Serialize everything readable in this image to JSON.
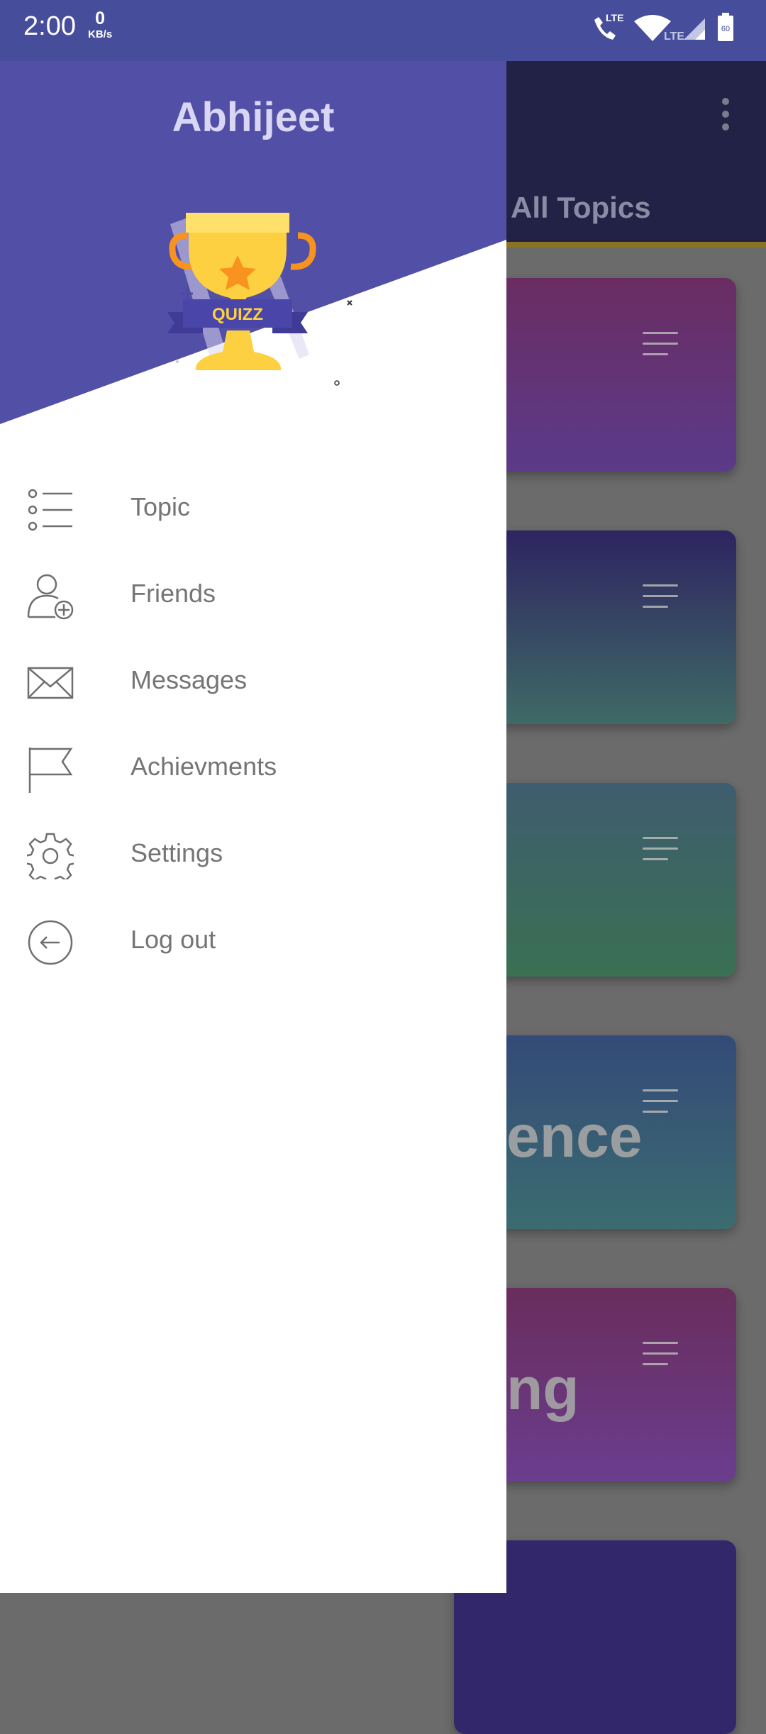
{
  "status_bar": {
    "time": "2:00",
    "net_speed_value": "0",
    "net_speed_unit": "KB/s",
    "call_badge": "LTE",
    "signal_badge": "LTE",
    "battery_level": "60"
  },
  "app": {
    "title": "All Topics",
    "cards": [
      {
        "text": "",
        "gradient": [
          "#6a2d62",
          "#5b3a8a"
        ]
      },
      {
        "text": "",
        "gradient": [
          "#2e2461",
          "#3f6a66"
        ]
      },
      {
        "text": "",
        "gradient": [
          "#3e5d6e",
          "#3b7053"
        ]
      },
      {
        "text": "ence",
        "gradient": [
          "#344a78",
          "#3b6c70"
        ]
      },
      {
        "text": "ng",
        "gradient": [
          "#6a2d5c",
          "#6a3d8e"
        ]
      },
      {
        "text": "",
        "gradient": [
          "#31276a",
          "#31276a"
        ]
      }
    ]
  },
  "drawer": {
    "user_name": "Abhijeet",
    "badge_text": "QUIZZ",
    "menu": [
      {
        "label": "Topic",
        "icon": "list-icon"
      },
      {
        "label": "Friends",
        "icon": "add-user-icon"
      },
      {
        "label": "Messages",
        "icon": "envelope-icon"
      },
      {
        "label": "Achievments",
        "icon": "flag-icon"
      },
      {
        "label": "Settings",
        "icon": "gear-icon"
      },
      {
        "label": "Log out",
        "icon": "logout-icon"
      }
    ]
  },
  "colors": {
    "status_bar": "#464e9c",
    "drawer_header": "#524fa6",
    "trophy_gold": "#fdd041",
    "trophy_handle": "#f7931e",
    "ribbon": "#4a45a8"
  }
}
